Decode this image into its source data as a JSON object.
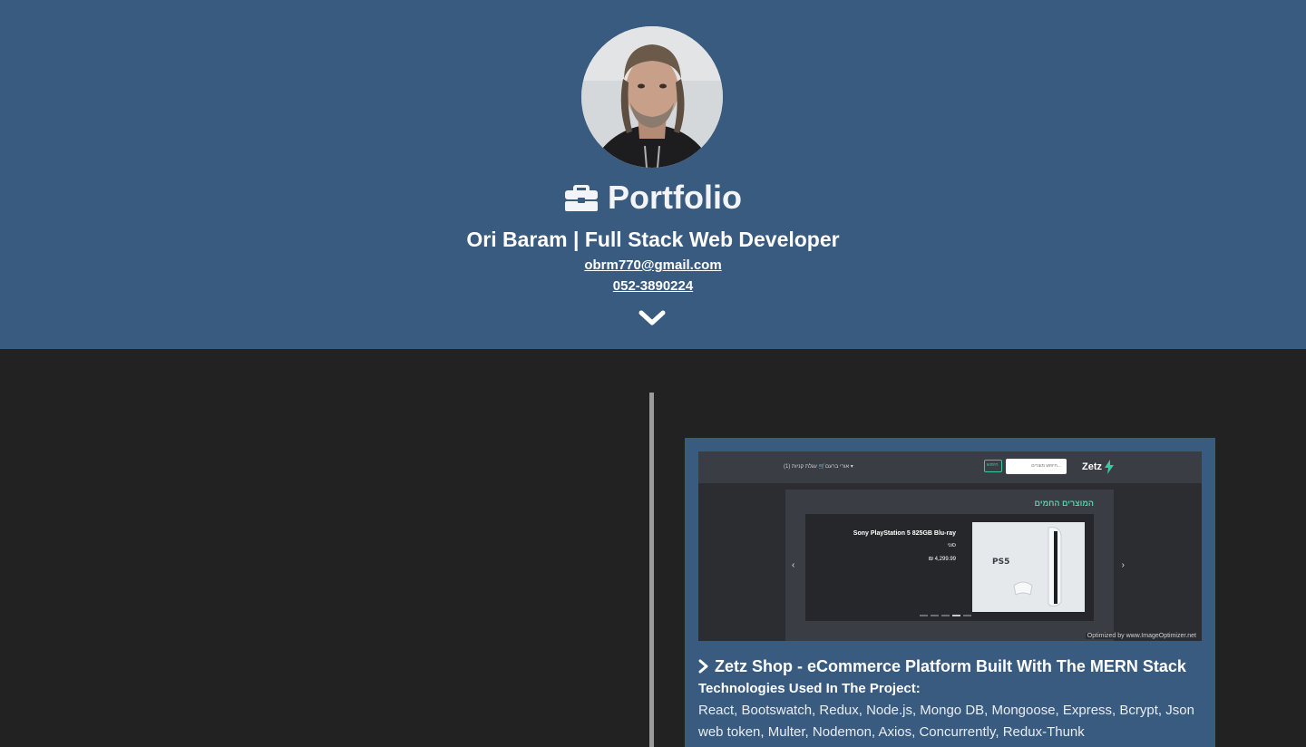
{
  "header": {
    "title": "Portfolio",
    "subtitle": "Ori Baram | Full Stack Web Developer",
    "email": "obrm770@gmail.com",
    "phone": "052-3890224",
    "icons": {
      "title_icon": "briefcase-icon",
      "scroll_icon": "chevron-down-icon"
    },
    "colors": {
      "background": "#395b80",
      "text": "#ffffff"
    }
  },
  "timeline": {
    "colors": {
      "background": "#222222",
      "line": "#9a9a9a"
    }
  },
  "project": {
    "title": "Zetz Shop - eCommerce Platform Built With The MERN Stack",
    "technologies_label": "Technologies Used In The Project:",
    "technologies": "React, Bootswatch, Redux, Node.js, Mongo DB, Mongoose, Express, Bcrypt, Json web token, Multer, Nodemon, Axios, Concurrently, Redux-Thunk",
    "screenshot": {
      "logo": "Zetz",
      "cart_text": "עגלת קניות (1) 🛒",
      "user_text": "אורי ברעם ▾",
      "search_placeholder": "חיפוש מוצרים...",
      "search_button": "חיפוש",
      "section_title": "המוצרים החמים",
      "product_name": "Sony PlayStation 5 825GB Blu-ray",
      "product_sub": "סוני",
      "product_price": "₪ 4,299.99",
      "product_badge": "PS5",
      "watermark": "Optimized by www.ImageOptimizer.net",
      "prev": "‹",
      "next": "›"
    }
  }
}
